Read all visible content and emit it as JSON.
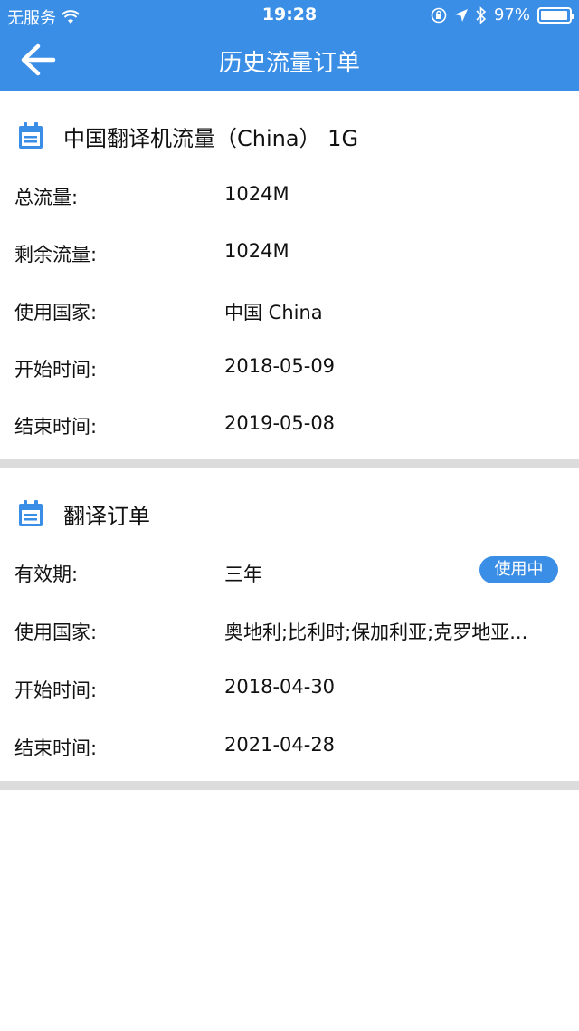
{
  "status_bar": {
    "carrier": "无服务",
    "time": "19:28",
    "battery": "97%",
    "battery_level": 0.97
  },
  "nav": {
    "title": "历史流量订单"
  },
  "flow_order": {
    "title": "中国翻译机流量（China） 1G",
    "rows": [
      {
        "label": "总流量:",
        "value": "1024M"
      },
      {
        "label": "剩余流量:",
        "value": "1024M"
      },
      {
        "label": "使用国家:",
        "value": "中国  China"
      },
      {
        "label": "开始时间:",
        "value": "2018-05-09"
      },
      {
        "label": "结束时间:",
        "value": "2019-05-08"
      }
    ]
  },
  "translate_order": {
    "title": "翻译订单",
    "status": "使用中",
    "rows": [
      {
        "label": "有效期:",
        "value": "三年"
      },
      {
        "label": "使用国家:",
        "value": "奥地利;比利时;保加利亚;克罗地亚..."
      },
      {
        "label": "开始时间:",
        "value": "2018-04-30"
      },
      {
        "label": "结束时间:",
        "value": "2021-04-28"
      }
    ]
  },
  "colors": {
    "brand": "#3a8ee6",
    "divider": "#dcdcdc"
  }
}
